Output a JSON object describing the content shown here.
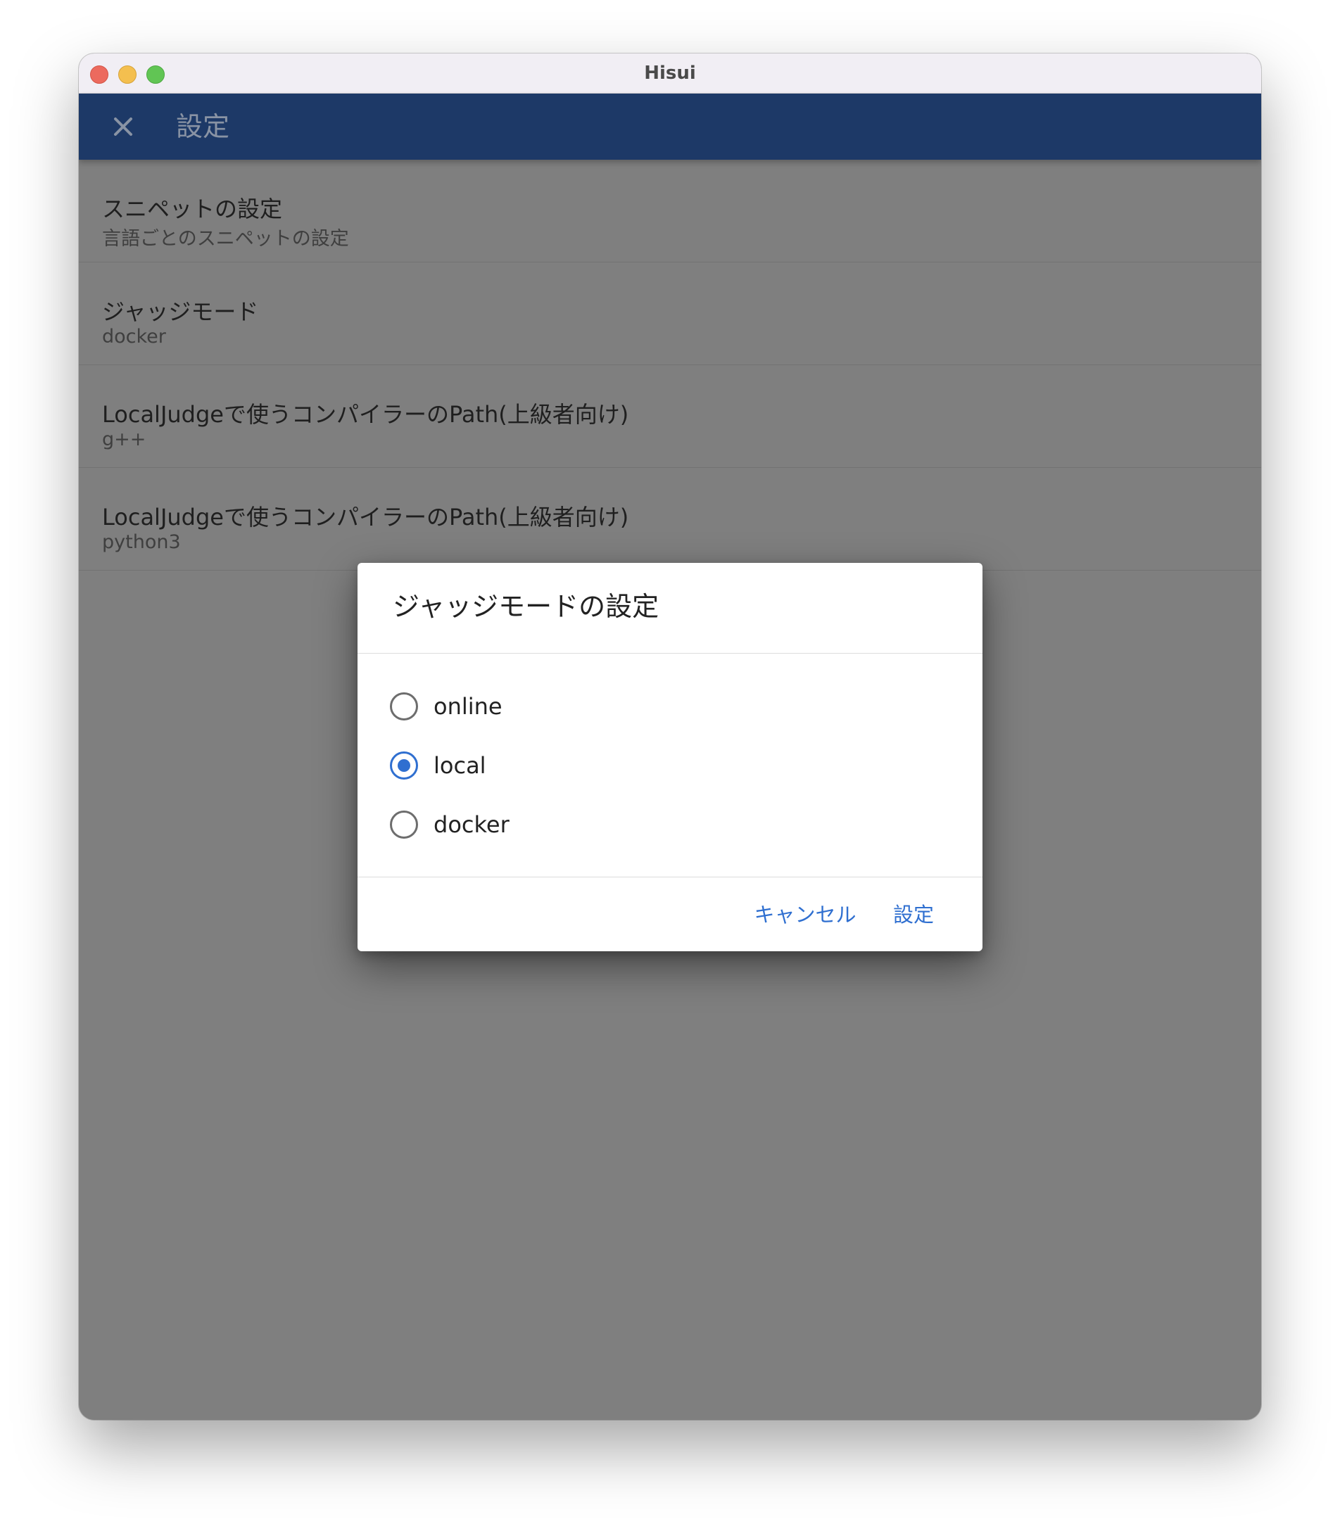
{
  "window": {
    "title": "Hisui"
  },
  "appbar": {
    "title": "設定",
    "close_icon": "close-icon"
  },
  "settings": {
    "items": [
      {
        "title": "スニペットの設定",
        "subtitle": "言語ごとのスニペットの設定"
      },
      {
        "title": "ジャッジモード",
        "subtitle": "docker"
      },
      {
        "title": "LocalJudgeで使うコンパイラーのPath(上級者向け)",
        "subtitle": "g++"
      },
      {
        "title": "LocalJudgeで使うコンパイラーのPath(上級者向け)",
        "subtitle": "python3"
      }
    ]
  },
  "dialog": {
    "title": "ジャッジモードの設定",
    "options": [
      {
        "label": "online",
        "selected": false
      },
      {
        "label": "local",
        "selected": true
      },
      {
        "label": "docker",
        "selected": false
      }
    ],
    "cancel_label": "キャンセル",
    "confirm_label": "設定"
  },
  "colors": {
    "appbar": "#1d3967",
    "accent": "#2f6fd0",
    "overlay": "#7f7f7f"
  }
}
